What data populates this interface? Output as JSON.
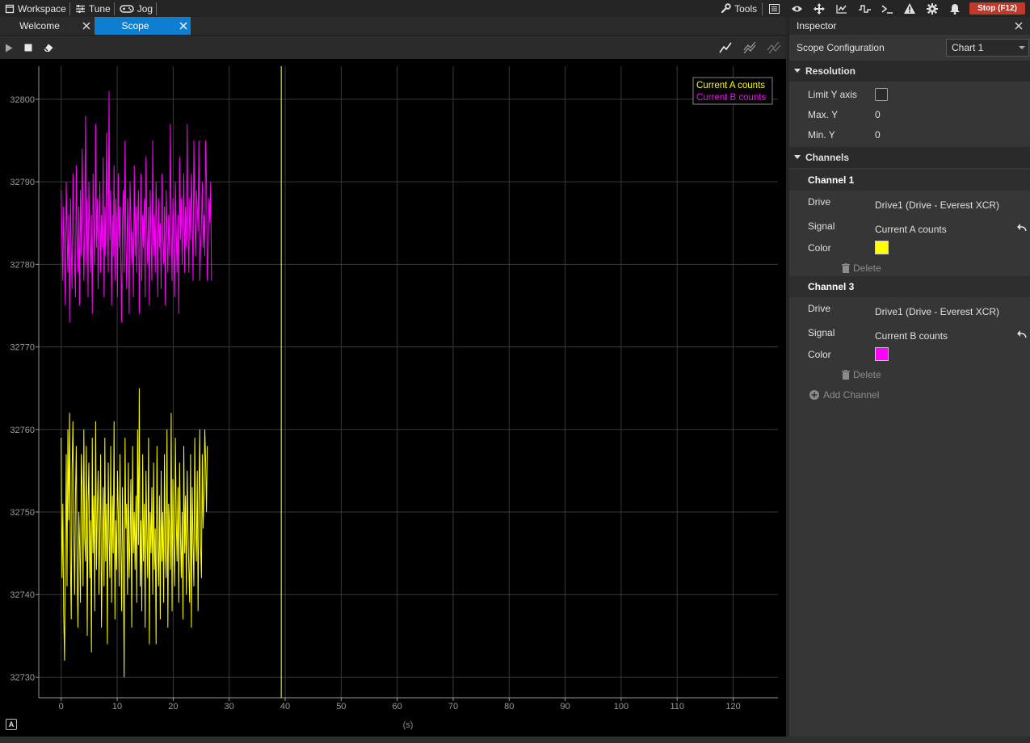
{
  "menu": {
    "workspace": "Workspace",
    "tune": "Tune",
    "jog": "Jog",
    "tools": "Tools",
    "stop": "Stop (F12)"
  },
  "tabs": [
    {
      "label": "Welcome",
      "active": false
    },
    {
      "label": "Scope",
      "active": true
    }
  ],
  "inspector": {
    "title": "Inspector",
    "config_label": "Scope Configuration",
    "chart_select": "Chart 1",
    "resolution": {
      "title": "Resolution",
      "limit_y_label": "Limit Y axis",
      "limit_y_checked": false,
      "max_y_label": "Max. Y",
      "max_y": "0",
      "min_y_label": "Min. Y",
      "min_y": "0"
    },
    "channels_title": "Channels",
    "channels": [
      {
        "title": "Channel 1",
        "drive_label": "Drive",
        "drive": "Drive1 (Drive - Everest XCR)",
        "signal_label": "Signal",
        "signal": "Current A counts",
        "color_label": "Color",
        "color": "#ffff00",
        "delete": "Delete"
      },
      {
        "title": "Channel 3",
        "drive_label": "Drive",
        "drive": "Drive1 (Drive - Everest XCR)",
        "signal_label": "Signal",
        "signal": "Current B counts",
        "color_label": "Color",
        "color": "#ff00ff",
        "delete": "Delete"
      }
    ],
    "add_channel": "Add Channel"
  },
  "chart_data": {
    "type": "line",
    "xlabel": "(s)",
    "ylabel": "",
    "xlim": [
      -4,
      128
    ],
    "ylim": [
      32727.5,
      32804
    ],
    "xticks": [
      0,
      10,
      20,
      30,
      40,
      50,
      60,
      70,
      80,
      90,
      100,
      110,
      120
    ],
    "yticks": [
      32730,
      32740,
      32750,
      32760,
      32770,
      32780,
      32790,
      32800
    ],
    "grid": true,
    "legend_position": "top-right",
    "cursor_x": 39.3,
    "series": [
      {
        "name": "Current A counts",
        "color": "#ffff00",
        "x_start": 0,
        "dx": 0.15,
        "values": [
          32759,
          32742,
          32751,
          32738,
          32732,
          32745,
          32757,
          32741,
          32760,
          32749,
          32762,
          32744,
          32737,
          32755,
          32761,
          32748,
          32740,
          32752,
          32758,
          32743,
          32736,
          32750,
          32746,
          32739,
          32757,
          32753,
          32741,
          32760,
          32747,
          32744,
          32758,
          32735,
          32751,
          32756,
          32742,
          32749,
          32733,
          32759,
          32745,
          32752,
          32738,
          32761,
          32743,
          32750,
          32755,
          32740,
          32748,
          32757,
          32736,
          32746,
          32753,
          32741,
          32759,
          32744,
          32751,
          32734,
          32756,
          32747,
          32742,
          32758,
          32739,
          32752,
          32745,
          32761,
          32737,
          32749,
          32743,
          32755,
          32750,
          32741,
          32757,
          32746,
          32738,
          32753,
          32744,
          32730,
          32759,
          32748,
          32751,
          32740,
          32756,
          32742,
          32747,
          32754,
          32736,
          32758,
          32745,
          32750,
          32743,
          32752,
          32739,
          32760,
          32746,
          32765,
          32741,
          32749,
          32738,
          32757,
          32744,
          32751,
          32736,
          32755,
          32747,
          32742,
          32759,
          32734,
          32750,
          32745,
          32753,
          32740,
          32756,
          32743,
          32748,
          32734,
          32758,
          32746,
          32741,
          32752,
          32737,
          32755,
          32744,
          32750,
          32739,
          32757,
          32745,
          32742,
          32760,
          32736,
          32751,
          32748,
          32743,
          32762,
          32738,
          32754,
          32746,
          32741,
          32759,
          32749,
          32744,
          32753,
          32739,
          32756,
          32747,
          32742,
          32750,
          32737,
          32758,
          32745,
          32752,
          32740,
          32755,
          32748,
          32743,
          32739,
          32757,
          32736,
          32753,
          32746,
          32741,
          32759,
          32748,
          32744,
          32755,
          32738,
          32751,
          32760,
          32746,
          32742,
          32757,
          32748,
          32752,
          32760,
          32756,
          32750,
          32758
        ]
      },
      {
        "name": "Current B counts",
        "color": "#ff00ff",
        "x_start": 0,
        "dx": 0.15,
        "values": [
          32789,
          32783,
          32778,
          32787,
          32781,
          32775,
          32790,
          32784,
          32779,
          32786,
          32773,
          32788,
          32782,
          32777,
          32791,
          32785,
          32780,
          32776,
          32792,
          32783,
          32779,
          32787,
          32775,
          32789,
          32781,
          32794,
          32786,
          32778,
          32784,
          32798,
          32780,
          32788,
          32776,
          32790,
          32783,
          32779,
          32786,
          32774,
          32791,
          32785,
          32780,
          32797,
          32782,
          32788,
          32777,
          32784,
          32790,
          32779,
          32786,
          32782,
          32793,
          32776,
          32787,
          32781,
          32796,
          32785,
          32779,
          32801,
          32783,
          32789,
          32775,
          32786,
          32781,
          32792,
          32778,
          32788,
          32784,
          32776,
          32791,
          32782,
          32787,
          32780,
          32773,
          32785,
          32789,
          32779,
          32795,
          32783,
          32777,
          32788,
          32782,
          32774,
          32790,
          32786,
          32780,
          32784,
          32776,
          32792,
          32781,
          32787,
          32779,
          32785,
          32789,
          32774,
          32783,
          32791,
          32778,
          32786,
          32782,
          32788,
          32776,
          32793,
          32784,
          32780,
          32787,
          32775,
          32789,
          32783,
          32778,
          32795,
          32781,
          32786,
          32779,
          32790,
          32784,
          32776,
          32788,
          32782,
          32785,
          32777,
          32791,
          32783,
          32780,
          32787,
          32775,
          32789,
          32784,
          32779,
          32786,
          32781,
          32797,
          32785,
          32778,
          32788,
          32782,
          32776,
          32790,
          32784,
          32779,
          32786,
          32774,
          32793,
          32783,
          32788,
          32780,
          32785,
          32791,
          32779,
          32787,
          32782,
          32797,
          32784,
          32779,
          32788,
          32783,
          32791,
          32786,
          32778,
          32795,
          32785,
          32781,
          32789,
          32787,
          32784,
          32795,
          32778,
          32782,
          32785,
          32790,
          32782,
          32786,
          32781,
          32795,
          32790,
          32778,
          32782,
          32788,
          32785,
          32790,
          32778
        ]
      }
    ]
  }
}
